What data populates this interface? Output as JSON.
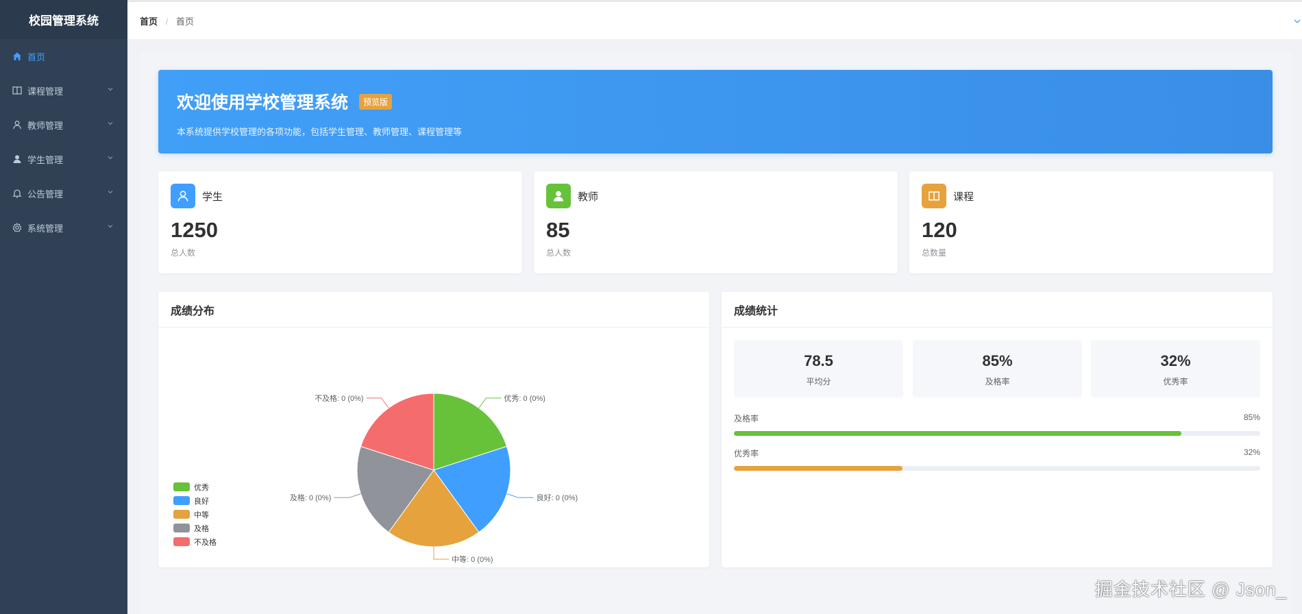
{
  "app": {
    "title": "校园管理系统"
  },
  "sidebar": {
    "items": [
      {
        "label": "首页",
        "icon": "home-icon",
        "active": true
      },
      {
        "label": "课程管理",
        "icon": "book-icon"
      },
      {
        "label": "教师管理",
        "icon": "user-outline-icon"
      },
      {
        "label": "学生管理",
        "icon": "user-solid-icon"
      },
      {
        "label": "公告管理",
        "icon": "bell-icon"
      },
      {
        "label": "系统管理",
        "icon": "gear-icon"
      }
    ]
  },
  "breadcrumb": {
    "first": "首页",
    "separator": "/",
    "last": "首页"
  },
  "banner": {
    "title": "欢迎使用学校管理系统",
    "tag": "预览版",
    "subtitle": "本系统提供学校管理的各项功能，包括学生管理、教师管理、课程管理等"
  },
  "stats": [
    {
      "label": "学生",
      "value": "1250",
      "sub": "总人数",
      "color": "#409eff",
      "icon": "user-outline-icon"
    },
    {
      "label": "教师",
      "value": "85",
      "sub": "总人数",
      "color": "#67c23a",
      "icon": "user-solid-icon"
    },
    {
      "label": "课程",
      "value": "120",
      "sub": "总数量",
      "color": "#e6a23c",
      "icon": "book-icon"
    }
  ],
  "pie_panel": {
    "title": "成绩分布"
  },
  "chart_data": {
    "type": "pie",
    "title": "成绩分布",
    "categories": [
      "优秀",
      "良好",
      "中等",
      "及格",
      "不及格"
    ],
    "values": [
      0,
      0,
      0,
      0,
      0
    ],
    "labels": [
      "优秀: 0 (0%)",
      "良好: 0 (0%)",
      "中等: 0 (0%)",
      "及格: 0 (0%)",
      "不及格: 0 (0%)"
    ],
    "colors": [
      "#67c23a",
      "#409eff",
      "#e6a23c",
      "#909399",
      "#f56c6c"
    ],
    "legend_position": "bottom-left"
  },
  "score_panel": {
    "title": "成绩统计",
    "kpis": [
      {
        "value": "78.5",
        "label": "平均分"
      },
      {
        "value": "85%",
        "label": "及格率"
      },
      {
        "value": "32%",
        "label": "优秀率"
      }
    ],
    "bars": [
      {
        "label": "及格率",
        "value_text": "85%",
        "fraction": 0.85,
        "color": "#67c23a"
      },
      {
        "label": "优秀率",
        "value_text": "32%",
        "fraction": 0.32,
        "color": "#e6a23c"
      }
    ]
  },
  "watermark": "掘金技术社区 @ Json_"
}
